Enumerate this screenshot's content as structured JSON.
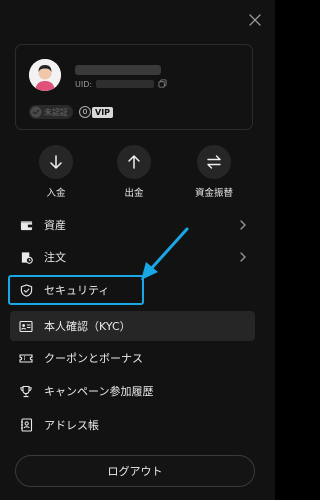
{
  "profile": {
    "uid_label": "UID:",
    "verification_status": "未認証",
    "vip_level": "0",
    "vip_label": "VIP"
  },
  "actions": [
    {
      "label": "入金",
      "icon": "arrow-down-icon"
    },
    {
      "label": "出金",
      "icon": "arrow-up-icon"
    },
    {
      "label": "資金振替",
      "icon": "transfer-icon"
    }
  ],
  "menu": {
    "assets": "資産",
    "orders": "注文",
    "security": "セキュリティ",
    "kyc": "本人確認（KYC）",
    "coupons": "クーポンとボーナス",
    "campaigns": "キャンペーン参加履歴",
    "address_book": "アドレス帳"
  },
  "logout_label": "ログアウト",
  "colors": {
    "background": "#121212",
    "highlight": "#1aa7e6",
    "vip_badge": "#d8d8d8"
  }
}
